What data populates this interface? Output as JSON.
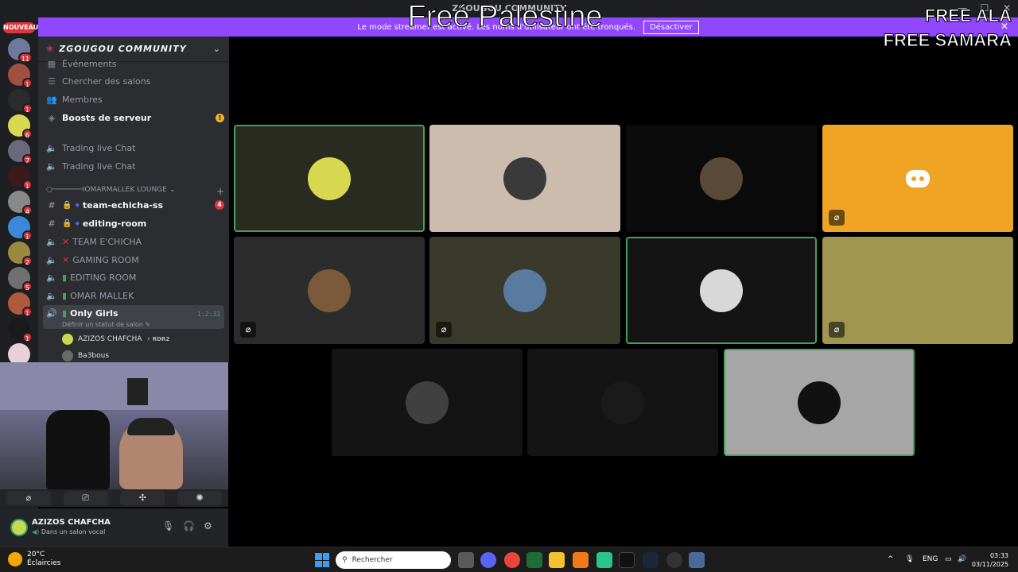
{
  "window": {
    "title": "ZGOUGOU COMMUNITY",
    "controls": [
      "—",
      "☐",
      "✕"
    ]
  },
  "overlays": {
    "center_text": "Freé Palestine",
    "right_line1": "FREE ALA",
    "right_line2": "FREE SAMARA"
  },
  "banner": {
    "message": "Le mode streamer est activé. Les noms d'utilisateur ont été tronqués.",
    "button": "Désactiver",
    "accent": "#9146ff"
  },
  "rail": {
    "new_label": "NOUVEAU",
    "servers": [
      {
        "badge": "11",
        "color": "#6c7a9c"
      },
      {
        "badge": "1",
        "color": "#a05040"
      },
      {
        "badge": "1",
        "color": "#2c2c2c"
      },
      {
        "badge": "6",
        "color": "#d8d850"
      },
      {
        "badge": "7",
        "color": "#6a6a7a"
      },
      {
        "badge": "1",
        "color": "#3a1a1a"
      },
      {
        "badge": "4",
        "color": "#888888"
      },
      {
        "badge": "1",
        "color": "#3a88d8"
      },
      {
        "badge": "2",
        "color": "#9a8a40"
      },
      {
        "badge": "5",
        "color": "#707070"
      },
      {
        "badge": "1",
        "color": "#b05a40"
      },
      {
        "badge": "1",
        "color": "#1a1a1a"
      },
      {
        "badge": "",
        "color": "#e8d0d8"
      }
    ]
  },
  "sidebar": {
    "guild_name": "ZGOUGOU COMMUNITY",
    "items_top": [
      {
        "icon": "calendar-icon",
        "glyph": "▦",
        "label": "Événements",
        "bright": false
      },
      {
        "icon": "list-icon",
        "glyph": "☰",
        "label": "Chercher des salons",
        "bright": false
      },
      {
        "icon": "members-icon",
        "glyph": "👥",
        "label": "Membres",
        "bright": false
      },
      {
        "icon": "boost-icon",
        "glyph": "◈",
        "label": "Boosts de serveur",
        "bright": true
      }
    ],
    "boost_warning": "!",
    "trading": [
      "Trading live Chat",
      "Trading live Chat"
    ],
    "category": "○───────IOMARMALLEK LOUNGE",
    "category_chev": "⌄",
    "category_add": "+",
    "text_channels": [
      {
        "name": "team-echicha-ss",
        "badge": "4"
      },
      {
        "name": "editing-room",
        "badge": ""
      }
    ],
    "voice_channels": [
      {
        "name": "TEAM E'CHICHA",
        "mark": "✕"
      },
      {
        "name": "GAMING ROOM",
        "mark": "✕"
      },
      {
        "name": "EDITING ROOM",
        "mark": "▮"
      },
      {
        "name": "OMAR MALLEK",
        "mark": "▮"
      }
    ],
    "active_channel": {
      "name": "Only Girls",
      "timer": "1:2:33",
      "status": "Définir un statut de salon ✎"
    },
    "voice_users": [
      {
        "name": "AZIZOS CHAFCHA",
        "tag": "⚡ RDR2",
        "color": "#c8d850"
      },
      {
        "name": "Ba3bous",
        "tag": "",
        "color": "#6a6a6a"
      }
    ]
  },
  "voice_controls": [
    "⌀",
    "⎚",
    "✣",
    "✺"
  ],
  "user": {
    "name": "AZIZOS CHAFCHA",
    "status": "Dans un salon vocal",
    "icons": [
      "🎙",
      "🎧",
      "⚙"
    ]
  },
  "tiles": [
    {
      "bg": "#2a2b20",
      "avatar": "#d8d850",
      "speaking": true,
      "muted": false
    },
    {
      "bg": "#cbbcae",
      "avatar": "#3a3a3a",
      "speaking": false,
      "muted": false
    },
    {
      "bg": "#0b0b0b",
      "avatar": "#5a4a3a",
      "speaking": false,
      "muted": false
    },
    {
      "bg": "#f0a423",
      "avatar": "#f0a423",
      "speaking": false,
      "muted": true,
      "discord": true
    },
    {
      "bg": "#2c2c2c",
      "avatar": "#7a5a3a",
      "speaking": false,
      "muted": true
    },
    {
      "bg": "#3a3a2c",
      "avatar": "#5a7aa0",
      "speaking": false,
      "muted": true
    },
    {
      "bg": "#141414",
      "avatar": "#d8d8d8",
      "speaking": true,
      "muted": false
    },
    {
      "bg": "#a09650",
      "avatar": "#a09650",
      "speaking": false,
      "muted": true
    },
    {
      "bg": "#141414",
      "avatar": "#404040",
      "speaking": false,
      "muted": false
    },
    {
      "bg": "#141414",
      "avatar": "#1a1a1a",
      "speaking": false,
      "muted": false
    },
    {
      "bg": "#a6a6a6",
      "avatar": "#111111",
      "speaking": true,
      "muted": false
    }
  ],
  "taskbar": {
    "temp": "20°C",
    "weather": "Éclaircies",
    "search": "Rechercher",
    "lang": "ENG",
    "time": "03:33",
    "date": "03/11/2025",
    "tray_arrow": "^"
  }
}
